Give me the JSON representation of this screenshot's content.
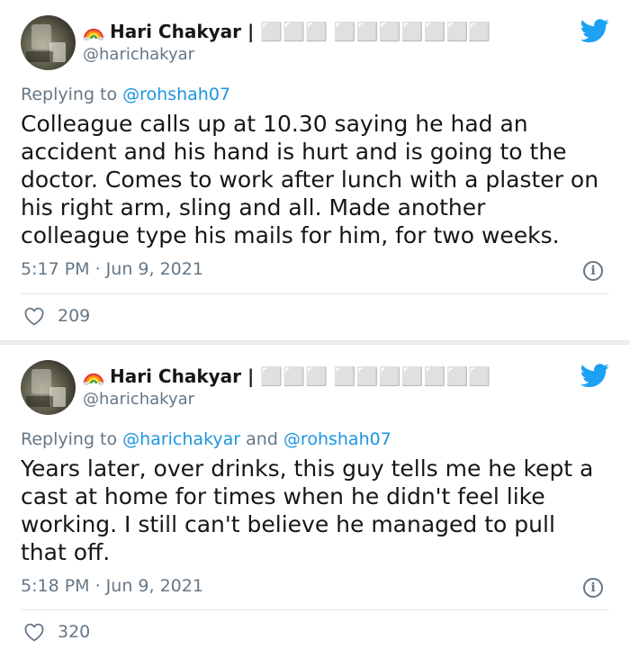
{
  "tweets": [
    {
      "display_name": "Hari Chakyar | ⬜⬜⬜ ⬜⬜⬜⬜⬜⬜⬜",
      "handle": "@harichakyar",
      "replying_prefix": "Replying to ",
      "replying_to": "@rohshah07",
      "body_lines": [
        "Colleague calls up at 10.30 saying he had an",
        "accident and his hand is hurt and is going to the",
        "doctor. Comes to work after lunch with a plaster on",
        "his right arm, sling and all. Made another",
        "colleague type his mails for him, for two weeks."
      ],
      "timestamp": "5:17 PM · Jun 9, 2021",
      "like_count": "209"
    },
    {
      "display_name": "Hari Chakyar | ⬜⬜⬜ ⬜⬜⬜⬜⬜⬜⬜",
      "handle": "@harichakyar",
      "replying_prefix": "Replying to ",
      "replying_to": "@harichakyar",
      "replying_and": " and ",
      "replying_to_2": "@rohshah07",
      "body_lines": [
        "Years later, over drinks, this guy tells me he kept a",
        "cast at home for times when he didn't feel like",
        "working. I still can't believe he managed to pull",
        "that off."
      ],
      "timestamp": "5:18 PM · Jun 9, 2021",
      "like_count": "320"
    }
  ],
  "icons": {
    "brand": "twitter-bird-icon",
    "emoji": "rainbow-icon",
    "info": "info-icon",
    "like": "heart-icon",
    "info_glyph": "i"
  },
  "colors": {
    "twitter_blue": "#1da1f2",
    "mention": "#1b95e0",
    "secondary_text": "#657786"
  }
}
